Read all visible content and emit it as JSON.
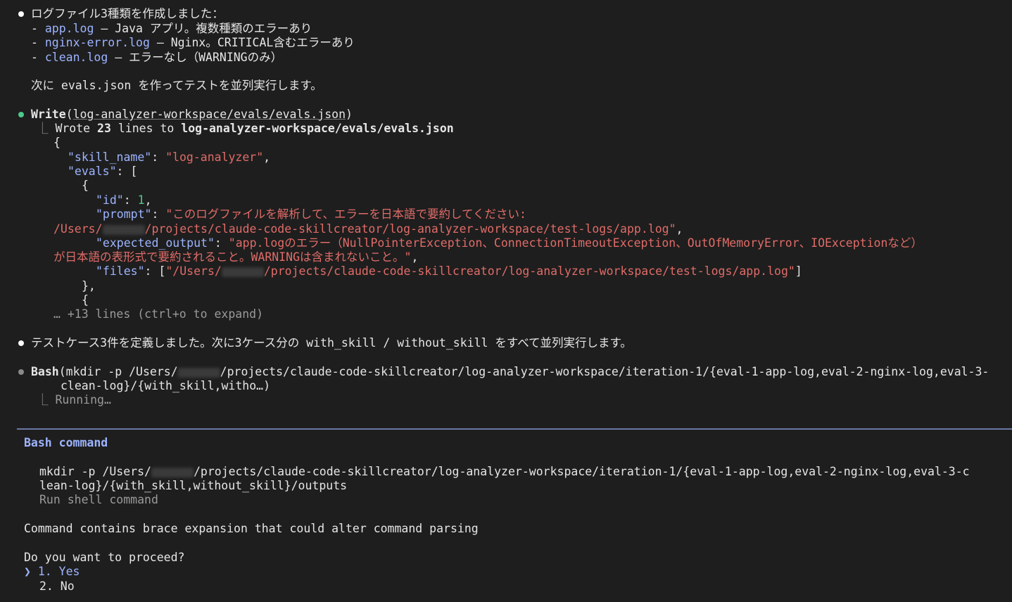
{
  "summary": {
    "title": "ログファイル3種類を作成しました：",
    "files": [
      {
        "name": "app.log",
        "desc": " — Java アプリ。複数種類のエラーあり"
      },
      {
        "name": "nginx-error.log",
        "desc": " — Nginx。CRITICAL含むエラーあり"
      },
      {
        "name": "clean.log",
        "desc": " — エラーなし（WARNINGのみ）"
      }
    ],
    "next": "次に evals.json を作ってテストを並列実行します。"
  },
  "write": {
    "tool": "Write",
    "path": "log-analyzer-workspace/evals/evals.json",
    "result_prefix": "Wrote ",
    "line_count": "23",
    "result_mid": " lines to ",
    "result_path": "log-analyzer-workspace/evals/evals.json",
    "json": {
      "open": "{",
      "skill_key": "\"skill_name\"",
      "skill_val": "\"log-analyzer\"",
      "evals_key": "\"evals\"",
      "evals_open": ": [",
      "obj_open": "{",
      "id_key": "\"id\"",
      "id_val": "1",
      "prompt_key": "\"prompt\"",
      "prompt_val_1": "\"このログファイルを解析して、エラーを日本語で要約してください:",
      "prompt_val_2a": "/Users/",
      "prompt_val_2b": "/projects/claude-code-skillcreator/log-analyzer-workspace/test-logs/app.log\"",
      "expected_key": "\"expected_output\"",
      "expected_val_1": "\"app.logのエラー（NullPointerException、ConnectionTimeoutException、OutOfMemoryError、IOExceptionなど）",
      "expected_val_2": "が日本語の表形式で要約されること。WARNINGは含まれないこと。\"",
      "files_key": "\"files\"",
      "files_val_a": "\"/Users/",
      "files_val_b": "/projects/claude-code-skillcreator/log-analyzer-workspace/test-logs/app.log\"",
      "obj_close": "},",
      "obj_open2": "{",
      "more": "… +13 lines (ctrl+o to expand)"
    }
  },
  "tests": {
    "text": "テストケース3件を定義しました。次に3ケース分の with_skill / without_skill をすべて並列実行します。"
  },
  "bash": {
    "tool": "Bash",
    "args_1a": "(mkdir -p /Users/",
    "args_1b": "/projects/claude-code-skillcreator/log-analyzer-workspace/iteration-1/{eval-1-app-log,eval-2-nginx-log,eval-3-",
    "args_2": "clean-log}/{with_skill,witho…)",
    "status": "Running…"
  },
  "prompt": {
    "heading": "Bash command",
    "cmd_1a": "mkdir -p /Users/",
    "cmd_1b": "/projects/claude-code-skillcreator/log-analyzer-workspace/iteration-1/{eval-1-app-log,eval-2-nginx-log,eval-3-c",
    "cmd_2": "lean-log}/{with_skill,without_skill}/outputs",
    "desc": "Run shell command",
    "warning": "Command contains brace expansion that could alter command parsing",
    "question": "Do you want to proceed?",
    "options": [
      {
        "pointer": "❯",
        "label": "1. Yes"
      },
      {
        "label": "2. No"
      }
    ]
  },
  "colors": {
    "background": "#1e1e1e",
    "key": "#9db4ff",
    "string": "#e06c68",
    "number": "#4ec98a",
    "divider": "#6b78a8"
  }
}
